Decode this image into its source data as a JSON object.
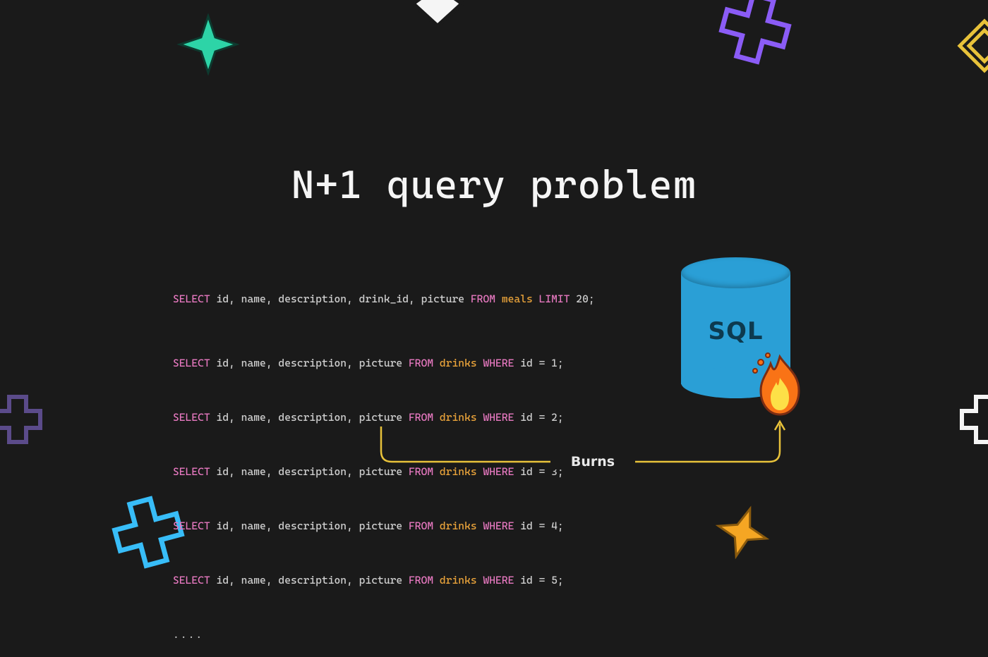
{
  "title": "N+1 query problem",
  "db_label": "SQL",
  "arrow_label": "Burns",
  "code": {
    "first_line": {
      "select": "SELECT",
      "cols": " id, name, description, drink_id, picture ",
      "from": "FROM",
      "table": " meals ",
      "limit": "LIMIT",
      "rest": " 20;"
    },
    "repeat_lines": [
      {
        "select": "SELECT",
        "cols": " id, name, description, picture ",
        "from": "FROM",
        "table": " drinks ",
        "where": "WHERE",
        "cond": " id = 1;"
      },
      {
        "select": "SELECT",
        "cols": " id, name, description, picture ",
        "from": "FROM",
        "table": " drinks ",
        "where": "WHERE",
        "cond": " id = 2;"
      },
      {
        "select": "SELECT",
        "cols": " id, name, description, picture ",
        "from": "FROM",
        "table": " drinks ",
        "where": "WHERE",
        "cond": " id = 3;"
      },
      {
        "select": "SELECT",
        "cols": " id, name, description, picture ",
        "from": "FROM",
        "table": " drinks ",
        "where": "WHERE",
        "cond": " id = 4;"
      },
      {
        "select": "SELECT",
        "cols": " id, name, description, picture ",
        "from": "FROM",
        "table": " drinks ",
        "where": "WHERE",
        "cond": " id = 5;"
      }
    ],
    "ellipsis": "...."
  },
  "colors": {
    "bg": "#1a1a1a",
    "keyword": "#e879c1",
    "table": "#e8a23a",
    "text": "#cfcfcf",
    "db": "#2a9fd6",
    "arrow": "#e8c23a",
    "teal": "#2dd4a7",
    "purple": "#8b5cf6",
    "blue": "#38bdf8",
    "orange": "#f5a623"
  }
}
